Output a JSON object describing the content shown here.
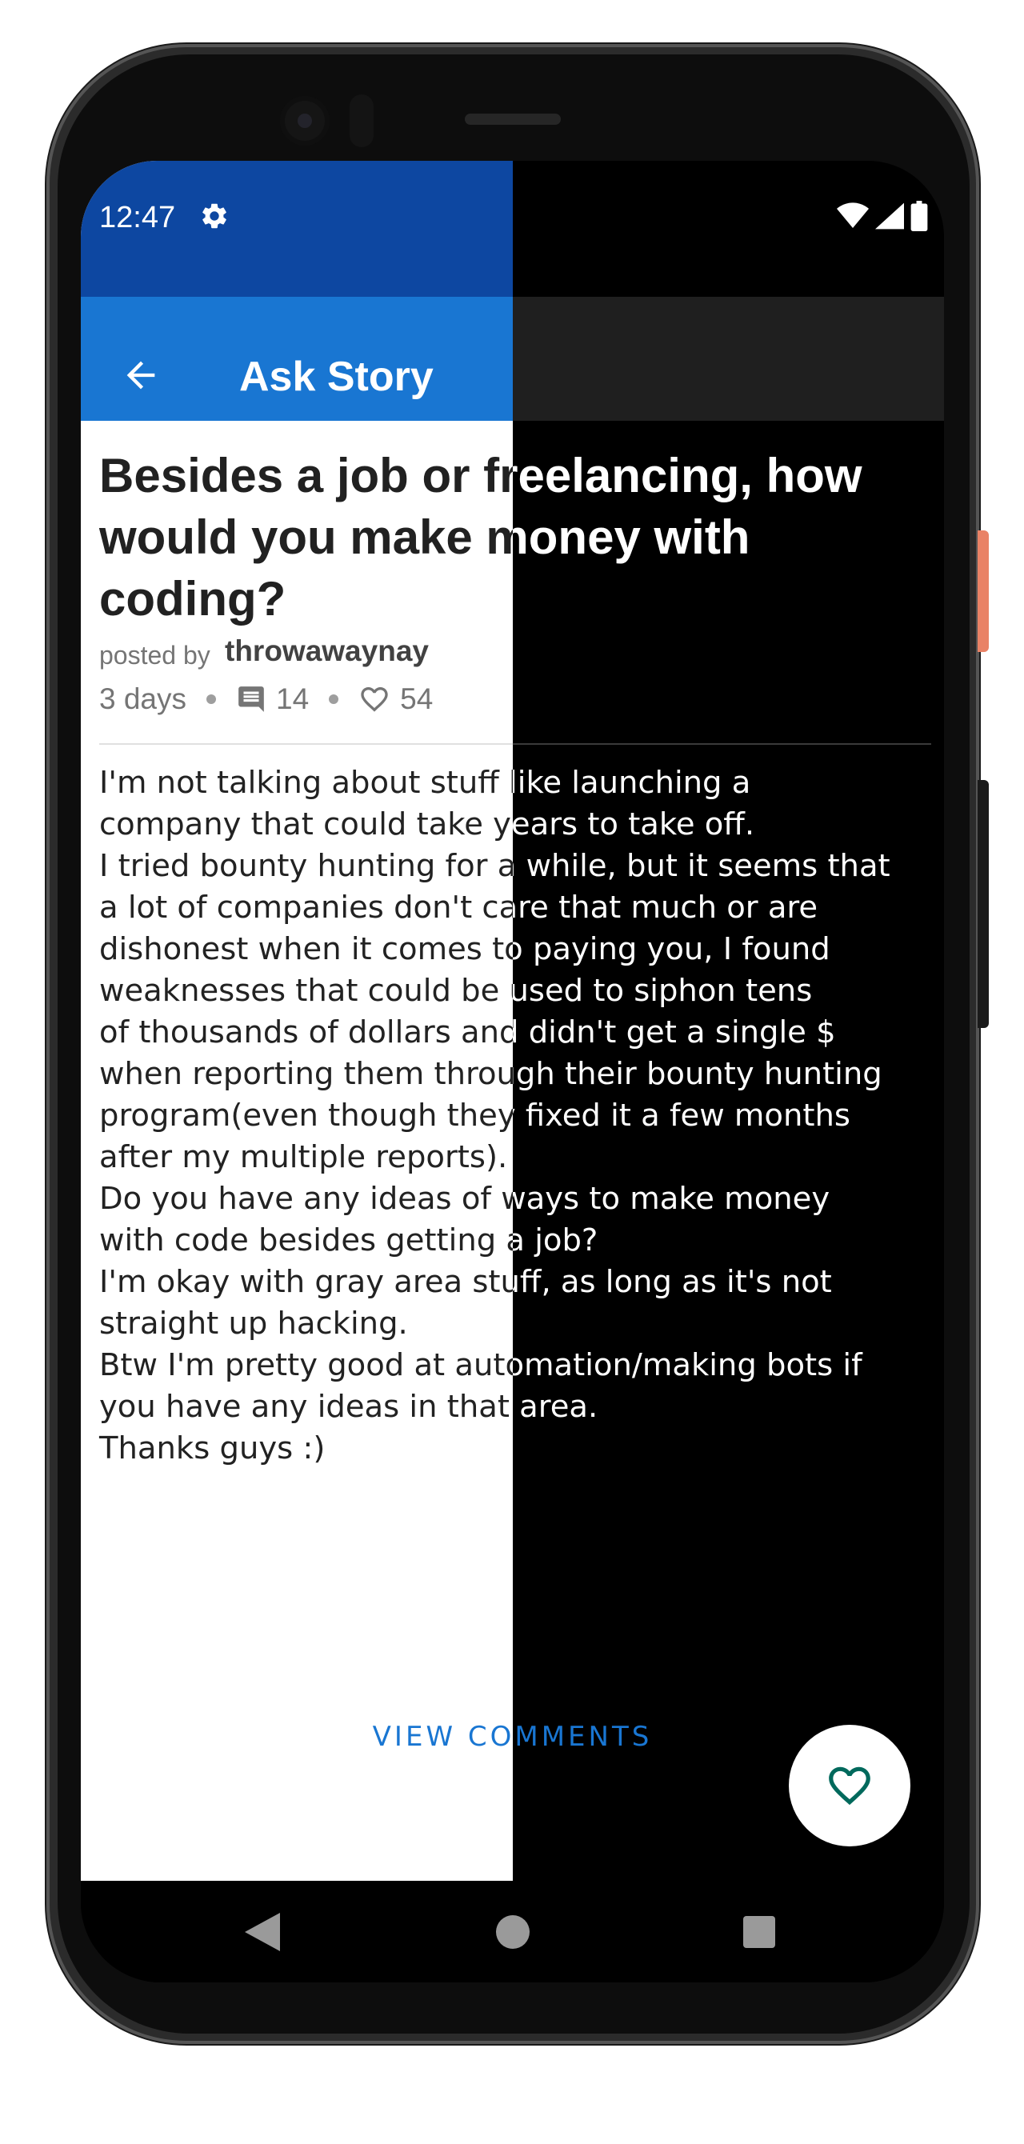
{
  "status_bar": {
    "time": "12:47",
    "icons": [
      "gear-icon",
      "wifi-icon",
      "signal-icon",
      "battery-icon"
    ]
  },
  "toolbar": {
    "title": "Ask Story",
    "back_icon": "arrow-back-icon"
  },
  "story": {
    "title": "Besides a job or freelancing, how would you make money with coding?",
    "posted_by_label": "posted by",
    "author": "throwawaynay",
    "age": "3 days",
    "comment_count": "14",
    "like_count": "54",
    "body": "I'm not talking about stuff like launching a\ncompany that could take years to take off.\nI tried bounty hunting for a while, but it seems that\na lot of companies don't care that much or are\ndishonest when it comes to paying you, I found\nweaknesses that could be used to siphon tens\nof thousands of dollars and didn't get a single $\nwhen reporting them through their bounty hunting\nprogram(even though they fixed it a few months\nafter my multiple reports).\nDo you have any ideas of ways to make money\nwith code besides getting a job?\nI'm okay with gray area stuff, as long as it's not\nstraight up hacking.\nBtw I'm pretty good at automation/making bots if\nyou have any ideas in that area.\nThanks guys :)"
  },
  "actions": {
    "view_comments": "VIEW COMMENTS",
    "fab_icon": "heart-outline-icon"
  },
  "colors": {
    "status_bar": "#0d47a1",
    "toolbar": "#1976d2",
    "accent": "#1976d2",
    "fab_icon": "#00695c"
  }
}
